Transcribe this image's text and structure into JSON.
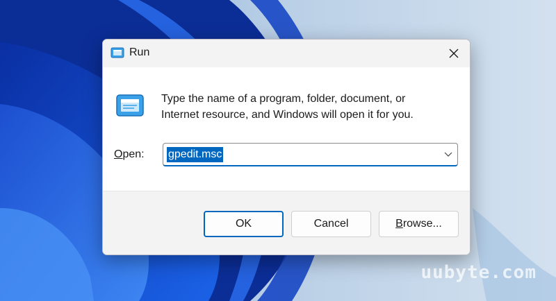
{
  "window": {
    "title": "Run"
  },
  "description": {
    "line1": "Type the name of a program, folder, document, or",
    "line2": "Internet resource, and Windows will open it for you."
  },
  "open_field": {
    "label_underlined": "O",
    "label_rest": "pen:",
    "value": "gpedit.msc"
  },
  "buttons": {
    "ok": "OK",
    "cancel": "Cancel",
    "browse_underlined": "B",
    "browse_rest": "rowse..."
  },
  "watermark": "uubyte.com",
  "icons": {
    "title": "run-app-icon",
    "close": "close-icon",
    "large": "run-large-icon",
    "dropdown": "chevron-down-icon"
  },
  "colors": {
    "accent": "#0067c0",
    "wallpaper_blue": "#1a5fd8"
  }
}
